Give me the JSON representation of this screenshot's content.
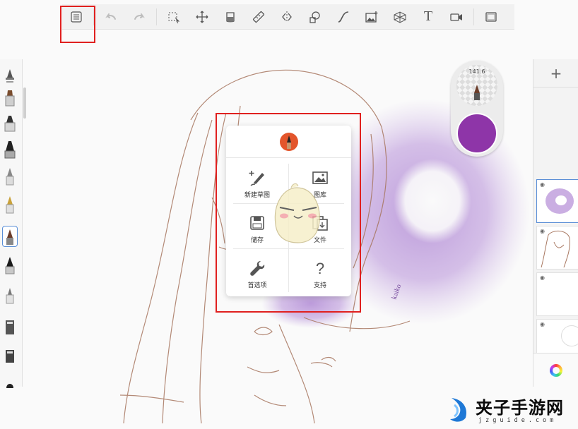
{
  "toolbar": {
    "items": [
      {
        "name": "menu-icon",
        "state": "enabled"
      },
      {
        "name": "undo-icon",
        "state": "disabled"
      },
      {
        "name": "redo-icon",
        "state": "disabled"
      },
      {
        "name": "selection-icon"
      },
      {
        "name": "transform-icon"
      },
      {
        "name": "fill-icon"
      },
      {
        "name": "ruler-icon"
      },
      {
        "name": "symmetry-icon"
      },
      {
        "name": "shapes-icon"
      },
      {
        "name": "curve-icon"
      },
      {
        "name": "import-image-icon"
      },
      {
        "name": "perspective-icon"
      },
      {
        "name": "text-icon",
        "glyph": "T"
      },
      {
        "name": "record-icon"
      },
      {
        "name": "fullscreen-icon"
      }
    ]
  },
  "brush_puck": {
    "size_label": "141.6",
    "color": "#8e35a8"
  },
  "popup_menu": {
    "items": [
      {
        "label": "新建草图",
        "icon": "new-sketch-icon"
      },
      {
        "label": "图库",
        "icon": "gallery-icon"
      },
      {
        "label": "储存",
        "icon": "save-icon"
      },
      {
        "label": "文件",
        "icon": "file-icon"
      },
      {
        "label": "首选项",
        "icon": "wrench-icon"
      },
      {
        "label": "支持",
        "icon": "question-icon"
      }
    ]
  },
  "layers": {
    "add_label": "+"
  },
  "canvas": {
    "signature": "kaiko"
  },
  "watermark": {
    "title": "夹子手游网",
    "url": "jzguide.com"
  },
  "colors": {
    "highlight": "#e0201f",
    "accent": "#5a8ed6",
    "brand": "#e3552b",
    "paint": "#8e35a8"
  }
}
